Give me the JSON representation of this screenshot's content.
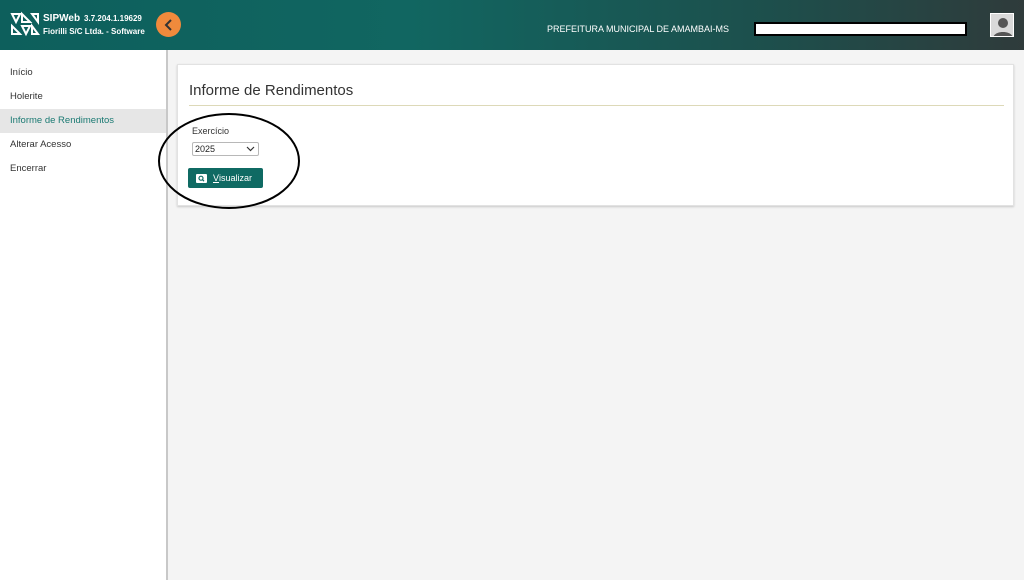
{
  "header": {
    "app_name": "SIPWeb",
    "version": "3.7.204.1.19629",
    "company": "Fiorilli S/C Ltda. - Software",
    "organization": "PREFEITURA MUNICIPAL DE AMAMBAI-MS",
    "collapse_icon": "chevron-left-icon",
    "avatar_icon": "user-avatar-icon"
  },
  "sidebar": {
    "items": [
      {
        "label": "Início",
        "active": false
      },
      {
        "label": "Holerite",
        "active": false
      },
      {
        "label": "Informe de Rendimentos",
        "active": true
      },
      {
        "label": "Alterar Acesso",
        "active": false
      },
      {
        "label": "Encerrar",
        "active": false
      }
    ]
  },
  "main": {
    "title": "Informe de Rendimentos",
    "field_label": "Exercício",
    "selected_year": "2025",
    "view_button": {
      "first_letter": "V",
      "rest": "isualizar",
      "icon": "search-icon"
    }
  },
  "colors": {
    "header_teal": "#116661",
    "accent_teal": "#1b7a73",
    "button": "#0f6a63",
    "toggle_orange": "#f08a3c"
  }
}
